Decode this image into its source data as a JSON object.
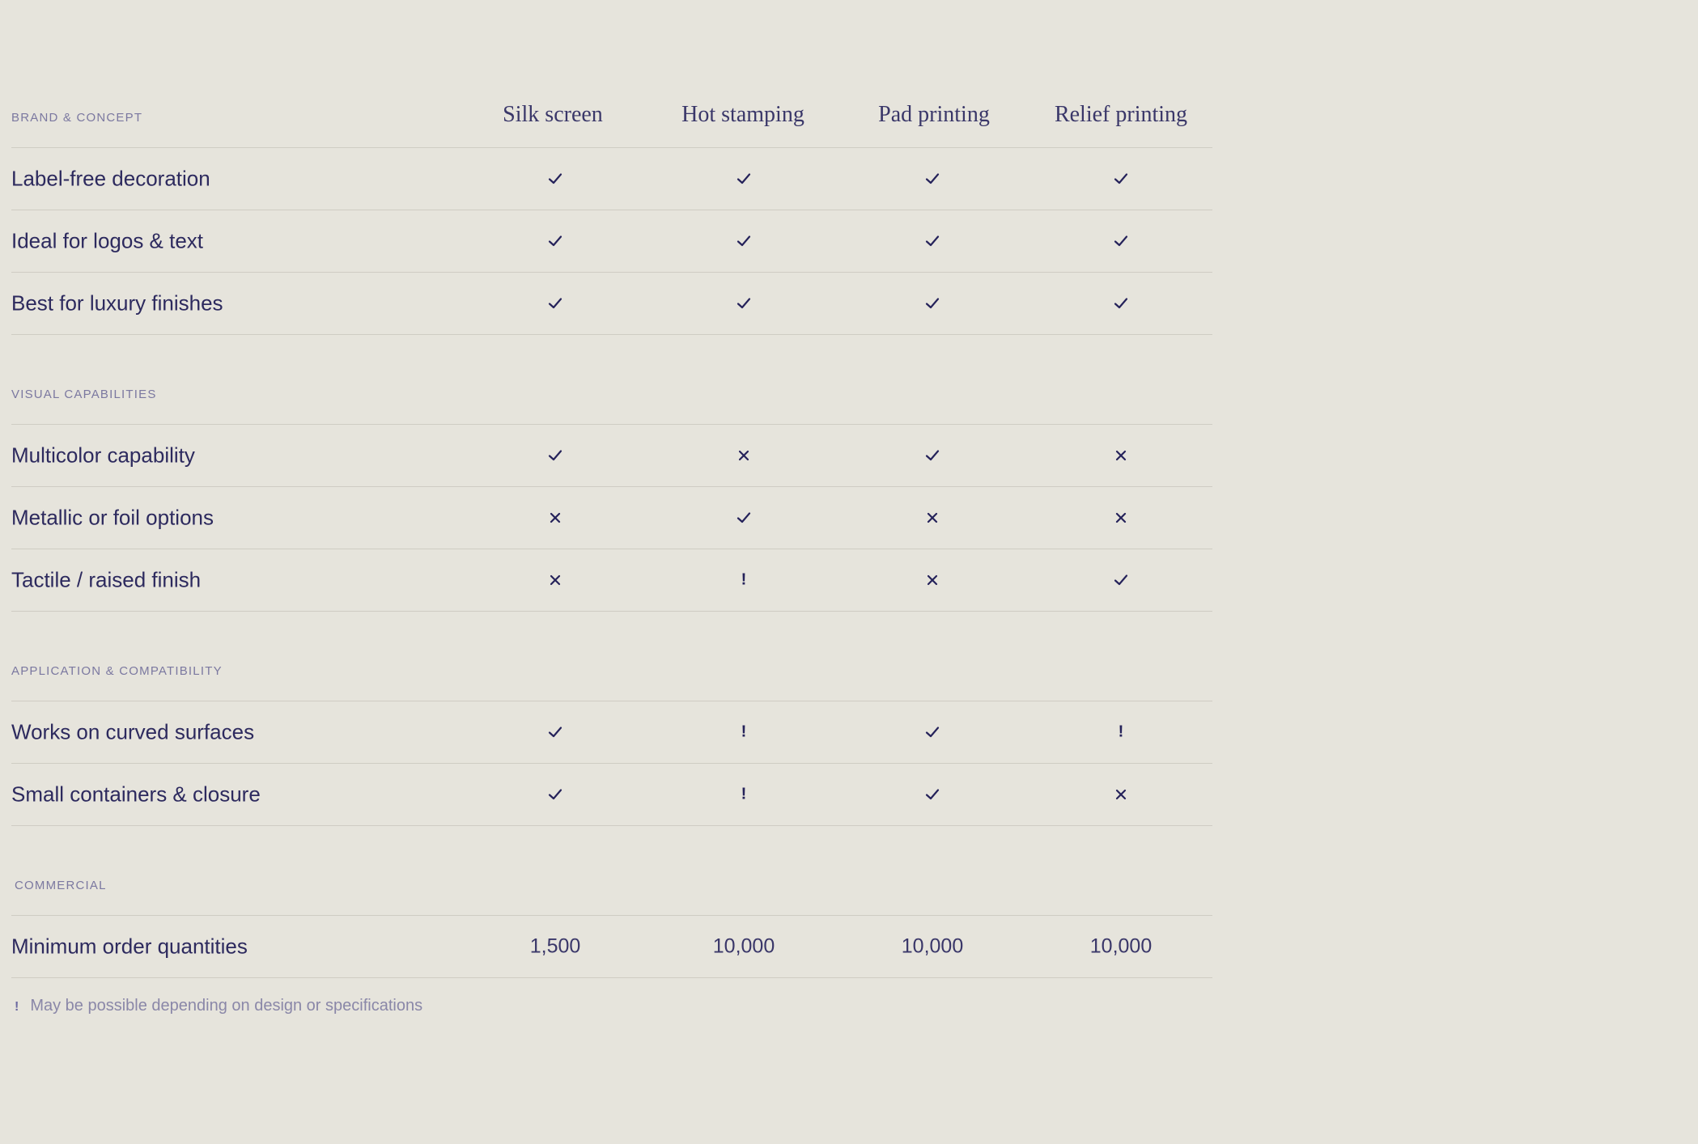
{
  "columns": [
    "Silk screen",
    "Hot stamping",
    "Pad printing",
    "Relief printing"
  ],
  "sections": [
    {
      "label": "BRAND & CONCEPT",
      "rows": [
        {
          "label": "Label-free decoration",
          "values": [
            "check",
            "check",
            "check",
            "check"
          ]
        },
        {
          "label": "Ideal for logos & text",
          "values": [
            "check",
            "check",
            "check",
            "check"
          ]
        },
        {
          "label": "Best for luxury finishes",
          "values": [
            "check",
            "check",
            "check",
            "check"
          ]
        }
      ]
    },
    {
      "label": "VISUAL CAPABILITIES",
      "rows": [
        {
          "label": "Multicolor capability",
          "values": [
            "check",
            "cross",
            "check",
            "cross"
          ]
        },
        {
          "label": "Metallic or foil options",
          "values": [
            "cross",
            "check",
            "cross",
            "cross"
          ]
        },
        {
          "label": "Tactile / raised finish",
          "values": [
            "cross",
            "!",
            "cross",
            "check"
          ]
        }
      ]
    },
    {
      "label": "APPLICATION & COMPATIBILITY",
      "rows": [
        {
          "label": "Works on curved surfaces",
          "values": [
            "check",
            "!",
            "check",
            "!"
          ]
        },
        {
          "label": "Small containers & closure",
          "values": [
            "check",
            "!",
            "check",
            "cross"
          ]
        }
      ]
    },
    {
      "label": "COMMERCIAL",
      "rows": [
        {
          "label": "Minimum order quantities",
          "values": [
            "1,500",
            "10,000",
            "10,000",
            "10,000"
          ]
        }
      ]
    }
  ],
  "footnote": {
    "mark": "!",
    "text": "May be possible depending on design or specifications"
  },
  "icons": {
    "check": "check-icon",
    "cross": "cross-icon",
    "warning": "exclamation-icon"
  },
  "colors": {
    "background": "#e6e4dc",
    "text": "#2d2a5e",
    "muted": "#7b78a0",
    "divider": "#cfccc3"
  }
}
